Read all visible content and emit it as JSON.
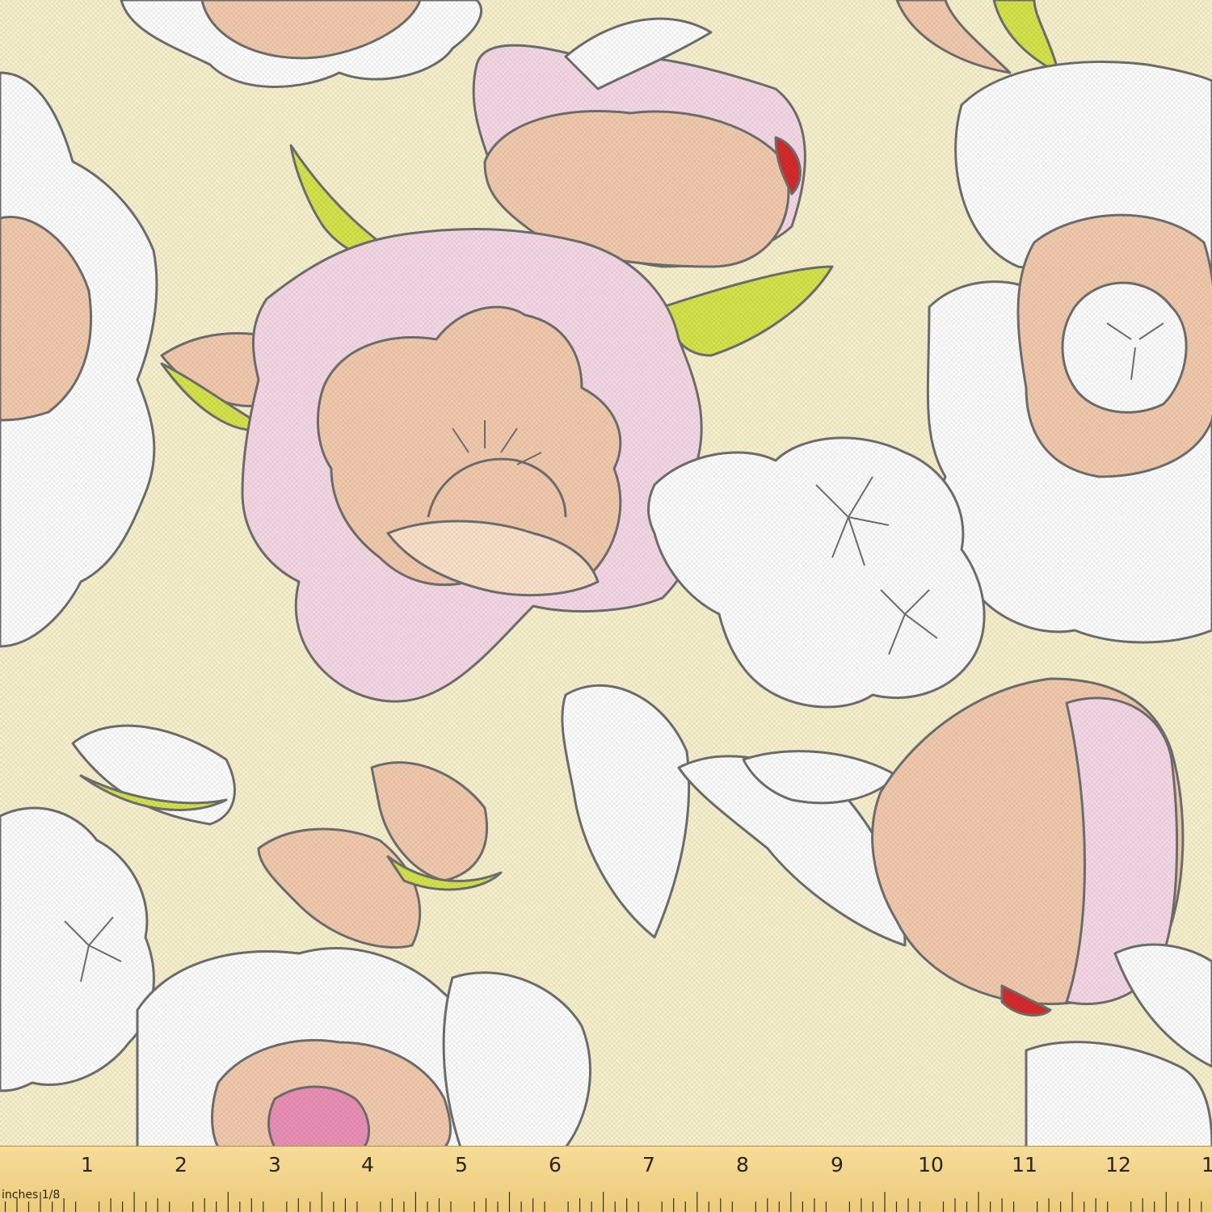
{
  "colors": {
    "background": "#f5eecb",
    "outline": "#6e6e6e",
    "shadow": "#6a6a6a",
    "pink": "#f3d6e3",
    "peach": "#f0c8ac",
    "white": "#fbfbfb",
    "leaf_green": "#d3e24a",
    "red": "#d42a2c",
    "magenta": "#e98eb4",
    "ruler": "#f1d48a"
  },
  "ruler": {
    "unit_label": "inches 1/8",
    "numbers": [
      "1",
      "2",
      "3",
      "4",
      "5",
      "6",
      "7",
      "8",
      "9",
      "10",
      "11",
      "12",
      "1"
    ]
  }
}
